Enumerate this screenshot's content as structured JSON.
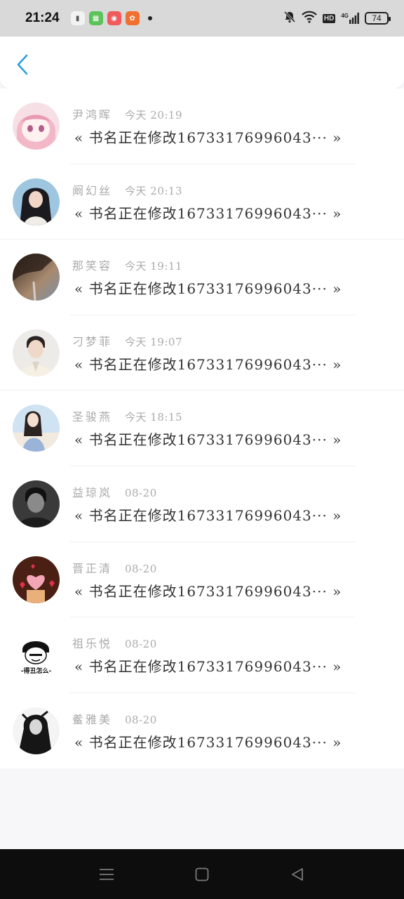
{
  "status_bar": {
    "time": "21:24",
    "battery": "74",
    "hd": "HD",
    "network": "4G"
  },
  "colors": {
    "accent": "#2b9fd8",
    "status_bg": "#d9d9d9",
    "nav_bg": "#0d0d0d"
  },
  "header": {
    "back_icon": "chevron-left-icon"
  },
  "items": [
    {
      "name": "尹鸿晖",
      "time": "今天 20:19",
      "title": "« 书名正在修改16733176996043··· »",
      "avatar": "anime-girl"
    },
    {
      "name": "阚幻丝",
      "time": "今天 20:13",
      "title": "« 书名正在修改16733176996043··· »",
      "avatar": "woman-dark-hair"
    },
    {
      "name": "那笑容",
      "time": "今天 19:11",
      "title": "« 书名正在修改16733176996043··· »",
      "avatar": "silhouette-smoke"
    },
    {
      "name": "刁梦菲",
      "time": "今天 19:07",
      "title": "« 书名正在修改16733176996043··· »",
      "avatar": "young-man"
    },
    {
      "name": "圣骏燕",
      "time": "今天 18:15",
      "title": "« 书名正在修改16733176996043··· »",
      "avatar": "girl-sky"
    },
    {
      "name": "益琼岚",
      "time": "08-20",
      "title": "« 书名正在修改16733176996043··· »",
      "avatar": "man-dark"
    },
    {
      "name": "晋正清",
      "time": "08-20",
      "title": "« 书名正在修改16733176996043··· »",
      "avatar": "hearts"
    },
    {
      "name": "祖乐悦",
      "time": "08-20",
      "title": "« 书名正在修改16733176996043··· »",
      "avatar": "meme",
      "avatar_text": "-得丑怎么-"
    },
    {
      "name": "鲝雅美",
      "time": "08-20",
      "title": "« 书名正在修改16733176996043··· »",
      "avatar": "bw-girl"
    }
  ]
}
